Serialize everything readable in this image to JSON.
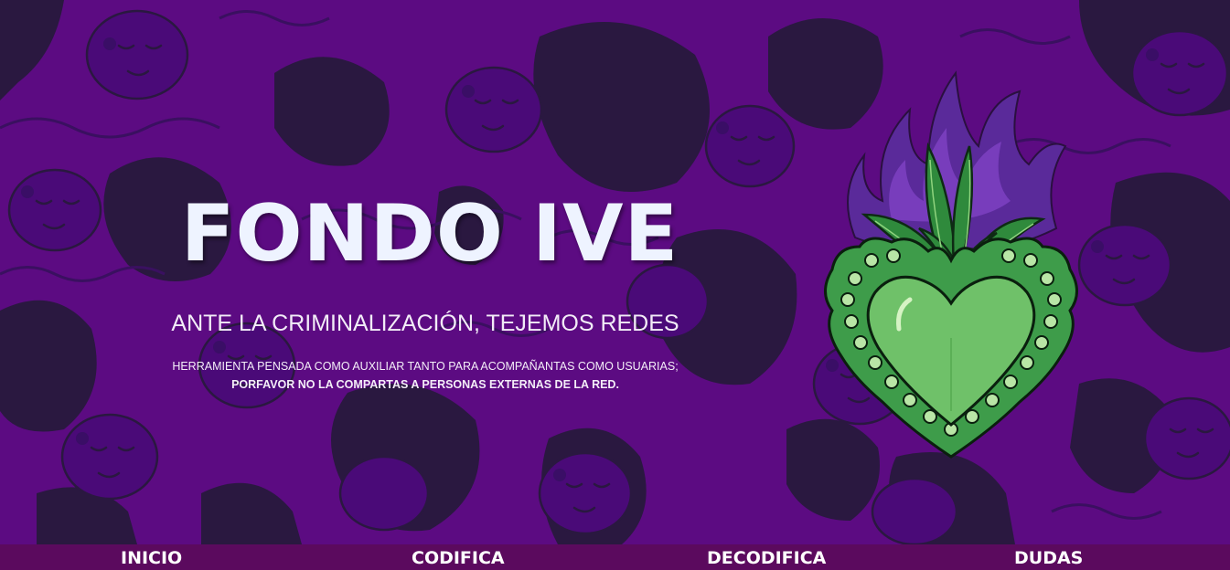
{
  "hero": {
    "title": "FONDO IVE",
    "subtitle": "ANTE LA CRIMINALIZACIÓN, TEJEMOS REDES",
    "description_line1": "HERRAMIENTA PENSADA COMO AUXILIAR TANTO PARA ACOMPAÑANTAS COMO USUARIAS;",
    "description_line2": "PORFAVOR NO LA COMPARTAS A PERSONAS EXTERNAS DE LA RED."
  },
  "nav": {
    "items": [
      {
        "label": "INICIO"
      },
      {
        "label": "CODIFICA"
      },
      {
        "label": "DECODIFICA"
      },
      {
        "label": "DUDAS"
      }
    ]
  },
  "colors": {
    "background_purple": "#5c0b82",
    "pattern_dark": "#2a1840",
    "pattern_mid": "#4a0a78",
    "pattern_light": "#7a1ea8",
    "nav_bg": "#5b0a5e",
    "title_color": "#eef3ff",
    "heart_green": "#4caf50",
    "flame_purple": "#5a2a9a"
  },
  "icons": {
    "heart": "sacred-heart-illustration",
    "background": "crowd-of-faces-pattern"
  }
}
